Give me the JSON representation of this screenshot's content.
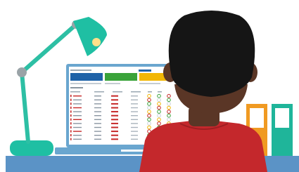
{
  "scene": {
    "kind": "illustration",
    "objects": [
      "desk-lamp",
      "laptop-with-dashboard",
      "person-seated-from-behind",
      "binders",
      "desk"
    ]
  },
  "colors": {
    "lamp_teal": "#1fbfa3",
    "lamp_arm": "#2dbfa4",
    "laptop_frame": "#6aa6cf",
    "desk_blue": "#5b93c6",
    "screen_bg": "#ffffff",
    "tile_blue": "#1f63a8",
    "tile_green": "#3aa33a",
    "tile_yellow": "#f2b705",
    "status_red": "#c62828",
    "hair_black": "#151515",
    "skin": "#5a3626",
    "shirt_red": "#c4282c",
    "binder_orange": "#f09a22",
    "binder_teal": "#1fb59a"
  }
}
